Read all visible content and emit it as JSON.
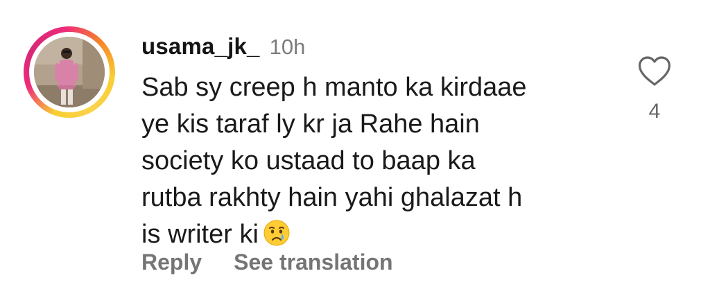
{
  "comment": {
    "username": "usama_jk_",
    "time_ago": "10h",
    "body_lines": [
      "Sab sy creep h manto ka kirdaae",
      "ye kis taraf ly kr ja Rahe hain",
      "society ko ustaad to baap ka",
      "rutba rakhty hain yahi ghalazat h",
      "is writer ki"
    ],
    "trailing_emoji": "crying-face",
    "like_count": "4",
    "like_icon": "heart-outline-icon"
  },
  "actions": {
    "reply_label": "Reply",
    "see_translation_label": "See translation"
  },
  "colors": {
    "ring_gradient": [
      "#f9ce34",
      "#ee2a7b",
      "#d62976",
      "#f58529"
    ],
    "secondary_text": "#757575"
  }
}
